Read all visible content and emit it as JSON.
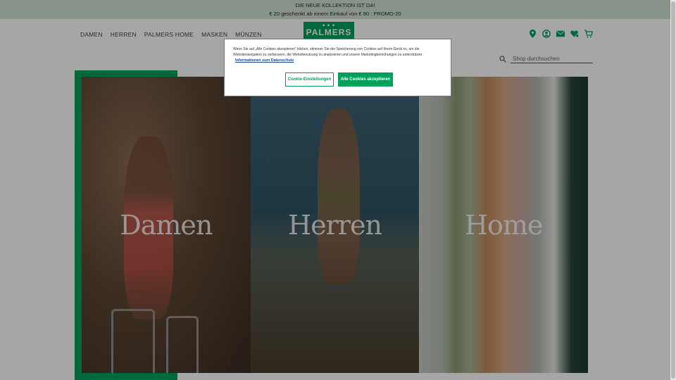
{
  "promo": {
    "line1": "DIE NEUE KOLLEKTION IST DA!",
    "line2": "€ 20 geschenkt ab einem Einkauf von € 80 : PROMO-20"
  },
  "nav": {
    "items": [
      "DAMEN",
      "HERREN",
      "PALMERS HOME",
      "MASKEN",
      "MÜNZEN"
    ]
  },
  "logo": {
    "text": "PALMERS"
  },
  "header_icons": [
    "location-pin-icon",
    "account-icon",
    "mail-icon",
    "wishlist-icon",
    "cart-icon"
  ],
  "search": {
    "placeholder": "Shop durchsuchen"
  },
  "tiles": [
    {
      "label": "Damen"
    },
    {
      "label": "Herren"
    },
    {
      "label": "Home"
    }
  ],
  "cookie": {
    "text": "Wenn Sie auf „Alle Cookies akzeptieren“ klicken, stimmen Sie der Speicherung von Cookies auf Ihrem Gerät zu, um die Websitenavigation zu verbessern, die Websitenutzung zu analysieren und unsere Marketingbemühungen zu unterstützen.",
    "link": "Informationen zum Datenschutz",
    "settings_label": "Cookie-Einstellungen",
    "accept_label": "Alle Cookies akzeptieren"
  },
  "colors": {
    "brand_green": "#00a15b",
    "promo_bg": "#cfe2d2"
  }
}
